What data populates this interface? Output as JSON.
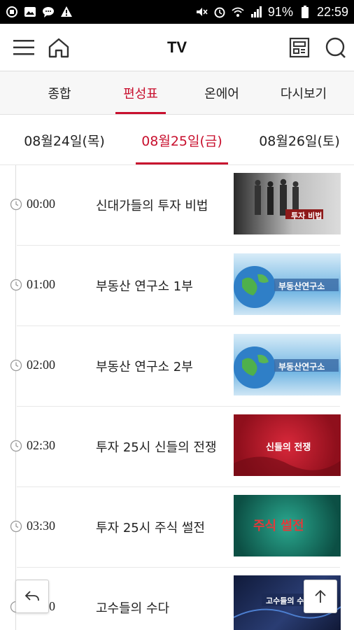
{
  "status_bar": {
    "left_icons": [
      "app-notification-icon",
      "image-icon",
      "chat-icon",
      "warning-icon"
    ],
    "right_icons": [
      "mute-icon",
      "alarm-icon",
      "wifi-icon",
      "signal-icon"
    ],
    "battery": "91%",
    "time": "22:59"
  },
  "header": {
    "title": "TV",
    "menu_icon": "hamburger-menu-icon",
    "home_icon": "home-icon",
    "newspaper_icon": "newspaper-icon",
    "search_icon": "search-icon"
  },
  "tabs": [
    {
      "label": "종합",
      "active": false
    },
    {
      "label": "편성표",
      "active": true
    },
    {
      "label": "온에어",
      "active": false
    },
    {
      "label": "다시보기",
      "active": false
    }
  ],
  "dates": [
    {
      "label": "08월24일(목)",
      "active": false
    },
    {
      "label": "08월25일(금)",
      "active": true
    },
    {
      "label": "08월26일(토)",
      "active": false
    }
  ],
  "schedule": [
    {
      "time": "00:00",
      "title": "신대가들의 투자 비법",
      "thumb_text": "투자 비법",
      "thumb_style": "gray"
    },
    {
      "time": "01:00",
      "title": "부동산 연구소 1부",
      "thumb_text": "부동산연구소",
      "thumb_style": "globe"
    },
    {
      "time": "02:00",
      "title": "부동산 연구소 2부",
      "thumb_text": "부동산연구소",
      "thumb_style": "globe"
    },
    {
      "time": "02:30",
      "title": "투자 25시 신들의 전쟁",
      "thumb_text": "신들의 전쟁",
      "thumb_style": "red"
    },
    {
      "time": "03:30",
      "title": "투자 25시 주식 썰전",
      "thumb_text": "주식 썰전",
      "thumb_style": "teal"
    },
    {
      "time": "03:30",
      "title": "고수들의 수다",
      "thumb_text": "고수들의 수다",
      "thumb_style": "dark"
    }
  ],
  "buttons": {
    "back_icon": "back-arrow-icon",
    "top_icon": "arrow-up-icon"
  },
  "colors": {
    "accent": "#c8102e",
    "text": "#222222",
    "tab_bg": "#f7f7f7"
  }
}
